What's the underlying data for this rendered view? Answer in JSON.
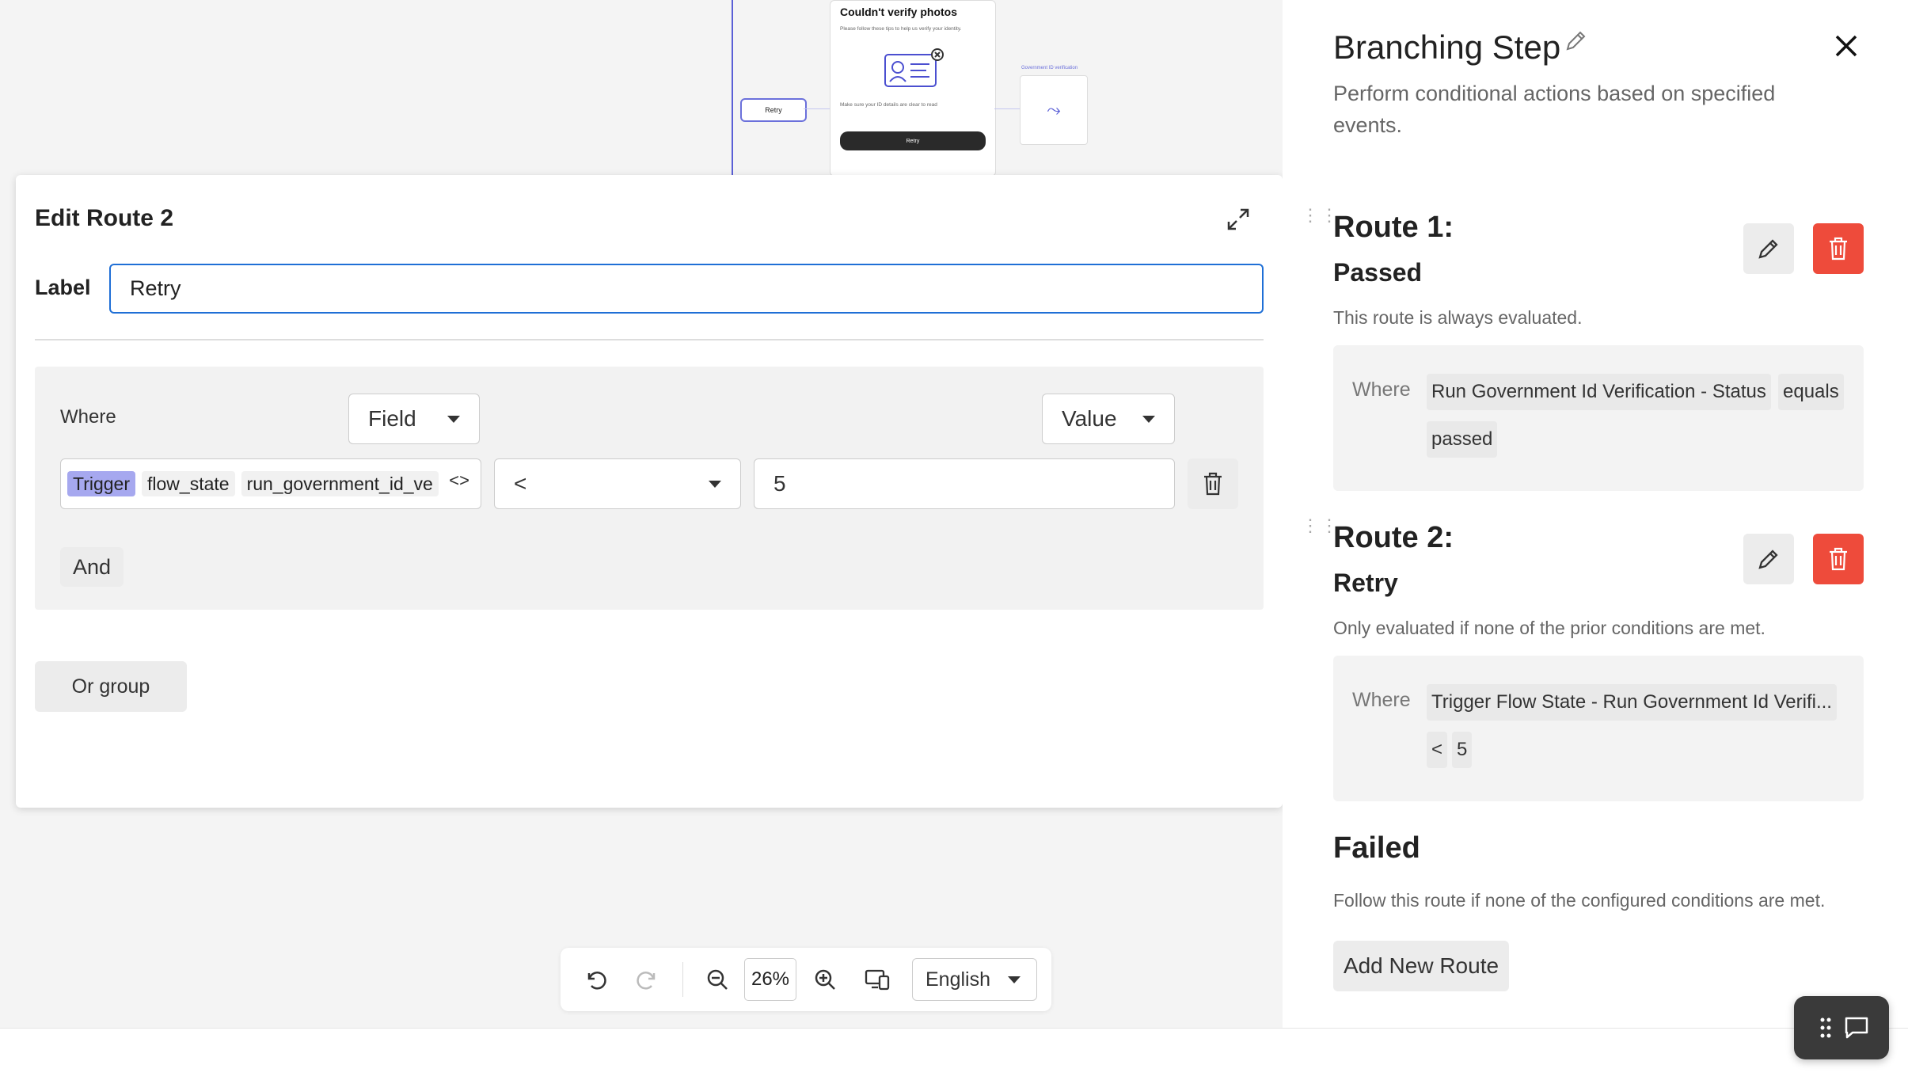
{
  "canvas": {
    "retry_node_label": "Retry",
    "screen_title": "Couldn't verify photos",
    "screen_subtitle": "Please follow these tips to help us verify your identity.",
    "screen_hint": "Make sure your ID details are clear to read",
    "screen_button": "Retry",
    "gov_node_label": "Government ID verification"
  },
  "edit_modal": {
    "title": "Edit Route 2",
    "label_caption": "Label",
    "label_value": "Retry",
    "where_label": "Where",
    "field_dropdown": "Field",
    "value_dropdown": "Value",
    "chips": [
      "Trigger",
      "flow_state",
      "run_government_id_ve"
    ],
    "operator": "<",
    "value": "5",
    "and_button": "And",
    "or_group_button": "Or group"
  },
  "toolbar": {
    "zoom": "26%",
    "language": "English"
  },
  "right_panel": {
    "title": "Branching Step",
    "subtitle": "Perform conditional actions based on specified events.",
    "routes": [
      {
        "title": "Route 1:",
        "name": "Passed",
        "description": "This route is always evaluated.",
        "where_label": "Where",
        "chips": [
          "Run Government Id Verification - Status",
          "equals",
          "passed"
        ]
      },
      {
        "title": "Route 2:",
        "name": "Retry",
        "description": "Only evaluated if none of the prior conditions are met.",
        "where_label": "Where",
        "chips": [
          "Trigger Flow State - Run Government Id Verifi...",
          "<",
          "5"
        ]
      }
    ],
    "failed_title": "Failed",
    "failed_description": "Follow this route if none of the configured conditions are met.",
    "add_route_button": "Add New Route"
  },
  "colors": {
    "accent_blue": "#1f6fd6",
    "delete_red": "#ee4b3b",
    "trigger_chip": "#a6a8ef",
    "canvas_line": "#5a5fd6"
  }
}
